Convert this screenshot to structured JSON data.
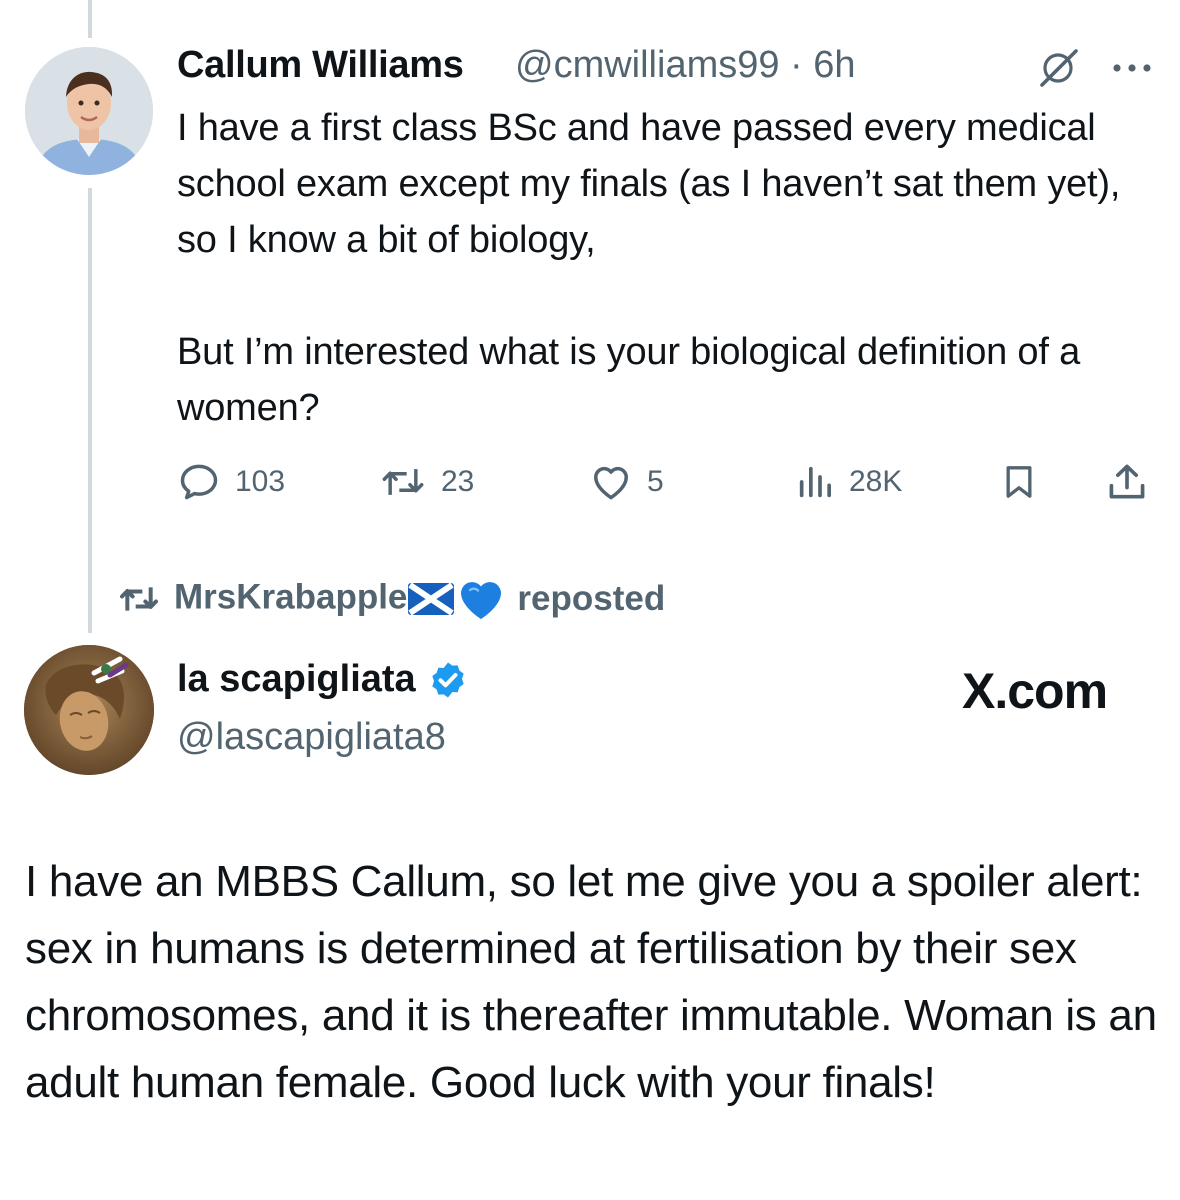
{
  "tweet1": {
    "author_name": "Callum Williams",
    "handle_time": "@cmwilliams99 · 6h",
    "body_lines": [
      "I have a first class BSc and have passed every medical school exam except my finals (as I haven’t sat them yet), so I know a bit of biology,",
      "But I’m interested what is your biological definition of a women?"
    ],
    "icons": [
      "grok-icon",
      "more-icon"
    ],
    "actions": {
      "replies": "103",
      "reposts": "23",
      "likes": "5",
      "views": "28K"
    }
  },
  "repost_banner": {
    "user": "MrsKrabapple",
    "emojis": [
      "scotland-flag-emoji",
      "blue-heart-emoji"
    ],
    "suffix": "reposted"
  },
  "tweet2": {
    "author_name": "la scapigliata",
    "verified": true,
    "handle": "@lascapigliata8",
    "watermark": "X.com",
    "body": "I have an MBBS Callum, so let me give you a spoiler alert: sex in humans is determined at fertilisation by their sex chromosomes, and it is thereafter immutable. Woman is an adult human female. Good luck with your finals!"
  },
  "colors": {
    "text": "#0f1419",
    "muted": "#536471",
    "thread_line": "#cfd9de",
    "verified_blue": "#1d9bf0"
  }
}
